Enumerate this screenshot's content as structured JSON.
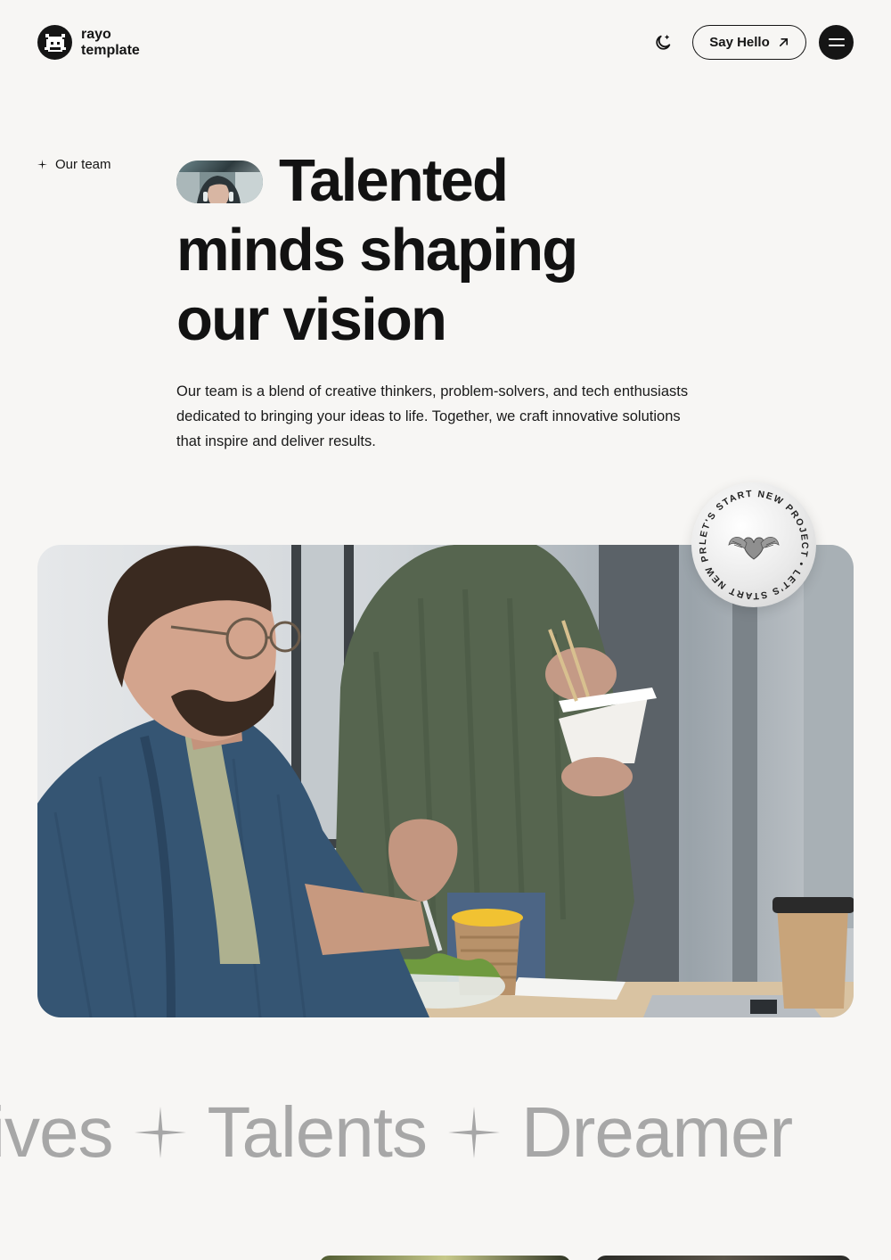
{
  "brand": {
    "line1": "rayo",
    "line2": "template"
  },
  "header": {
    "say_hello": "Say Hello",
    "theme_icon": "moon-stars-icon",
    "menu_icon": "hamburger-icon"
  },
  "hero": {
    "section_label": "Our team",
    "title_line1": "Talented",
    "title_line2": "minds shaping",
    "title_line3": "our vision",
    "description": "Our team is a blend of creative thinkers, problem-solvers, and tech enthusiasts dedicated to bringing your ideas to life. Together, we craft innovative solutions that inspire and deliver results."
  },
  "badge": {
    "circular_text": "LET'S START NEW PROJECT • LET'S START NEW PROJECT • "
  },
  "marquee": {
    "words": [
      "tives",
      "Talents",
      "Dreamer"
    ]
  },
  "colors": {
    "background": "#f7f6f4",
    "ink": "#121212",
    "marquee": "#a7a7a7"
  }
}
